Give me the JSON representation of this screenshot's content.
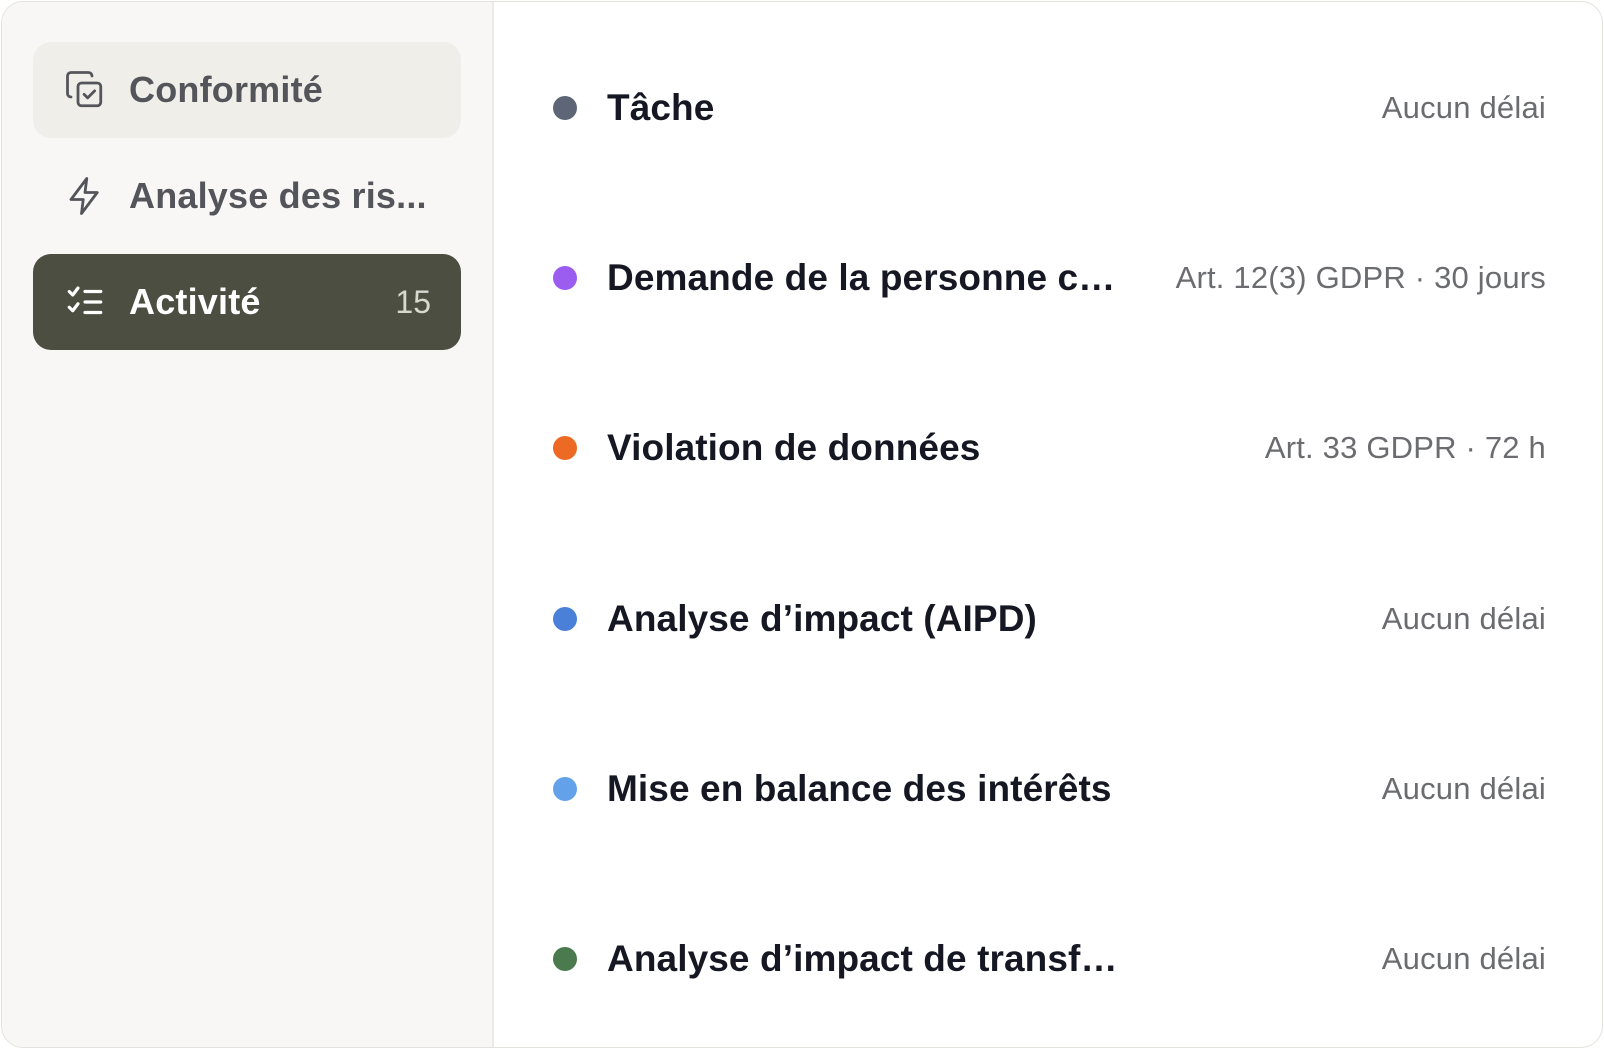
{
  "sidebar": {
    "items": [
      {
        "label": "Conformité",
        "icon": "copy-check-icon",
        "state": "hover"
      },
      {
        "label": "Analyse des ris...",
        "icon": "lightning-icon",
        "state": "default"
      },
      {
        "label": "Activité",
        "icon": "checklist-icon",
        "state": "active",
        "count": "15"
      }
    ]
  },
  "activities": [
    {
      "title": "Tâche",
      "meta": "Aucun délai",
      "color": "#5d6577"
    },
    {
      "title": "Demande de la personne co...",
      "meta": "Art. 12(3) GDPR · 30 jours",
      "color": "#9b5cf0"
    },
    {
      "title": "Violation de données",
      "meta": "Art. 33 GDPR · 72 h",
      "color": "#ec6a24"
    },
    {
      "title": "Analyse d’impact (AIPD)",
      "meta": "Aucun délai",
      "color": "#4a80d8"
    },
    {
      "title": "Mise en balance des intérêts",
      "meta": "Aucun délai",
      "color": "#63a2ea"
    },
    {
      "title": "Analyse d’impact de transfert",
      "meta": "Aucun délai",
      "color": "#4a7a4e"
    }
  ]
}
